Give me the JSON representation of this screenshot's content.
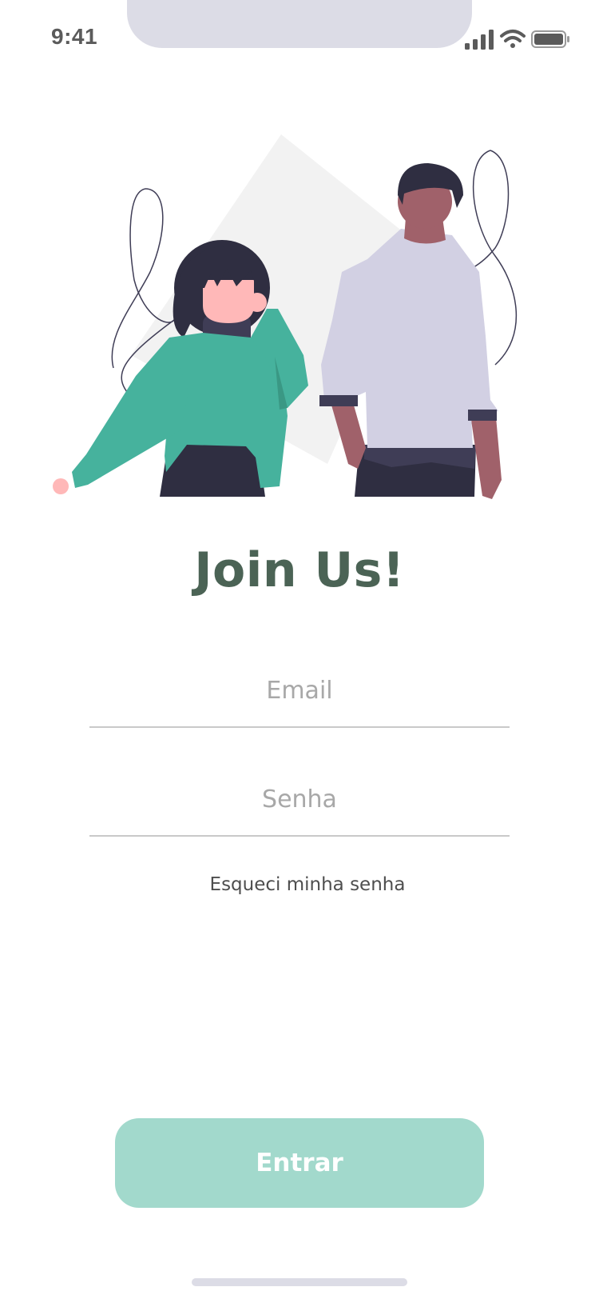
{
  "status_bar": {
    "time": "9:41",
    "icons": [
      "cellular-signal-icon",
      "wifi-icon",
      "battery-icon"
    ]
  },
  "illustration": {
    "description_icon": "two-people-illustration"
  },
  "title": "Join Us!",
  "form": {
    "email_placeholder": "Email",
    "email_value": "",
    "password_placeholder": "Senha",
    "password_value": "",
    "forgot_password_label": "Esqueci minha senha"
  },
  "actions": {
    "enter_label": "Entrar"
  },
  "colors": {
    "title": "#4b6355",
    "button_bg": "#a2d9cc",
    "sweater_green": "#46b29d",
    "shirt_lavender": "#d2d0e3",
    "dark_navy": "#2f2e41"
  }
}
